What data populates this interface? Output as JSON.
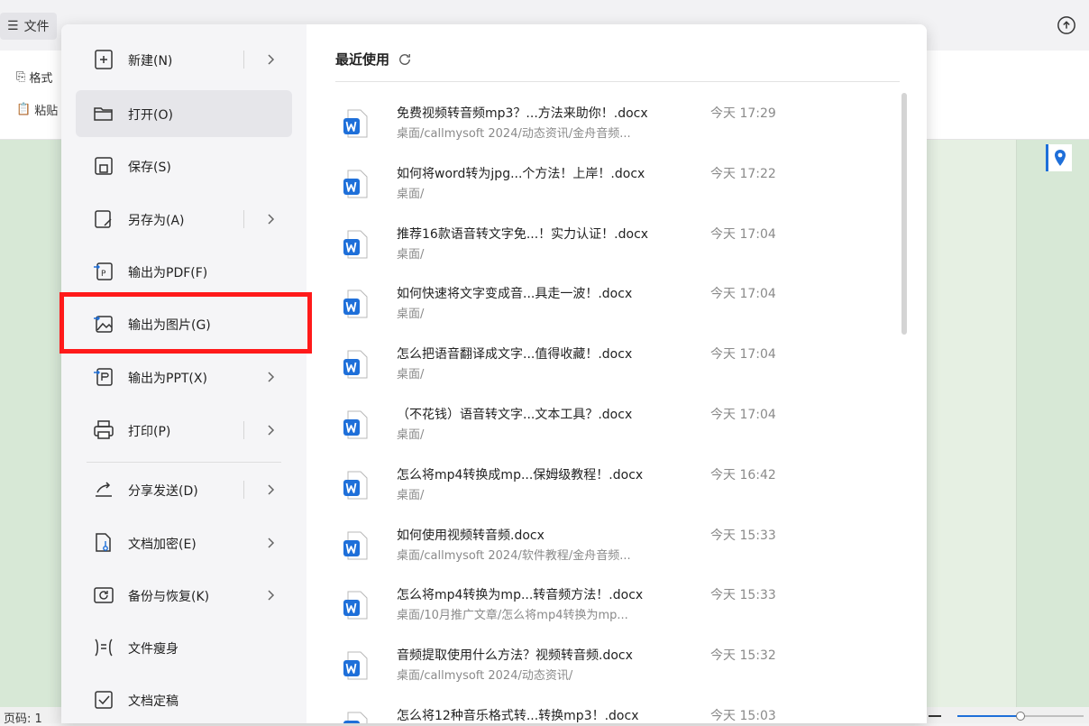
{
  "app": {
    "file_tab_label": "文件",
    "ribbon_items": [
      "格式",
      "粘贴"
    ],
    "status_page": "页码: 1"
  },
  "menu": {
    "items": [
      {
        "label": "新建(N)",
        "icon": "new-file-icon",
        "has_submenu": true
      },
      {
        "label": "打开(O)",
        "icon": "open-folder-icon",
        "has_submenu": false,
        "active": true
      },
      {
        "label": "保存(S)",
        "icon": "save-icon",
        "has_submenu": false
      },
      {
        "label": "另存为(A)",
        "icon": "save-as-icon",
        "has_submenu": true
      },
      {
        "label": "输出为PDF(F)",
        "icon": "export-pdf-icon",
        "has_submenu": false
      },
      {
        "label": "输出为图片(G)",
        "icon": "export-image-icon",
        "has_submenu": false,
        "highlighted": true
      },
      {
        "label": "输出为PPT(X)",
        "icon": "export-ppt-icon",
        "has_submenu": true
      },
      {
        "label": "打印(P)",
        "icon": "print-icon",
        "has_submenu": true
      },
      {
        "label": "分享发送(D)",
        "icon": "share-icon",
        "has_submenu": true
      },
      {
        "label": "文档加密(E)",
        "icon": "encrypt-icon",
        "has_submenu": true
      },
      {
        "label": "备份与恢复(K)",
        "icon": "backup-icon",
        "has_submenu": true
      },
      {
        "label": "文件瘦身",
        "icon": "slim-file-icon",
        "has_submenu": false
      },
      {
        "label": "文档定稿",
        "icon": "finalize-icon",
        "has_submenu": false
      }
    ]
  },
  "recent": {
    "title": "最近使用",
    "files": [
      {
        "name": "免费视频转音频mp3？...方法来助你！.docx",
        "path": "桌面/callmysoft 2024/动态资讯/金舟音频...",
        "time": "今天 17:29"
      },
      {
        "name": "如何将word转为jpg...个方法！上岸！.docx",
        "path": "桌面/",
        "time": "今天 17:22"
      },
      {
        "name": "推荐16款语音转文字免...！实力认证！.docx",
        "path": "桌面/",
        "time": "今天 17:04"
      },
      {
        "name": "如何快速将文字变成音...具走一波！.docx",
        "path": "桌面/",
        "time": "今天 17:04"
      },
      {
        "name": "怎么把语音翻译成文字...值得收藏！.docx",
        "path": "桌面/",
        "time": "今天 17:04"
      },
      {
        "name": "（不花钱）语音转文字...文本工具？.docx",
        "path": "桌面/",
        "time": "今天 17:04"
      },
      {
        "name": "怎么将mp4转换成mp...保姆级教程！.docx",
        "path": "桌面/",
        "time": "今天 16:42"
      },
      {
        "name": "如何使用视频转音频.docx",
        "path": "桌面/callmysoft 2024/软件教程/金舟音频...",
        "time": "今天 15:33"
      },
      {
        "name": "怎么将mp4转换为mp...转音频方法！.docx",
        "path": "桌面/10月推广文章/怎么将mp4转换为mp...",
        "time": "今天 15:33"
      },
      {
        "name": "音频提取使用什么方法？视频转音频.docx",
        "path": "桌面/callmysoft 2024/动态资讯/",
        "time": "今天 15:32"
      },
      {
        "name": "怎么将12种音乐格式转...转换mp3！.docx",
        "path": "",
        "time": "今天 15:03"
      }
    ]
  },
  "colors": {
    "highlight": "#ff1a1a",
    "word_icon": "#1e6fd9",
    "accent": "#1e6fd9"
  }
}
